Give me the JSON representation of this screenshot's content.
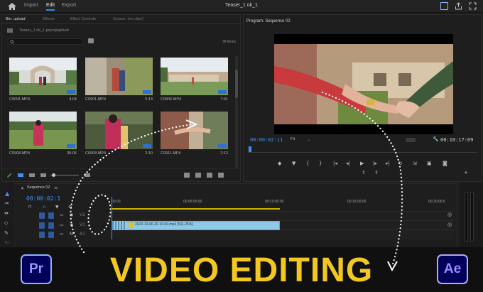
{
  "topbar": {
    "menus": [
      "Import",
      "Edit",
      "Export"
    ],
    "active_menu": "Edit",
    "title": "Teaser_1 ok_1"
  },
  "bin": {
    "tabs": [
      "Bin: upload",
      "Effects",
      "Effect Controls",
      "Source: (no clips)"
    ],
    "path": "Teaser_1 ok_1.prproj\\upload",
    "item_count": "38 Items",
    "clips": [
      {
        "name": "C0091.MP4",
        "duration": "4:04"
      },
      {
        "name": "C0901.MP4",
        "duration": "5:13"
      },
      {
        "name": "C0906.MP4",
        "duration": "7:01"
      },
      {
        "name": "C0908.MP4",
        "duration": "30:06"
      },
      {
        "name": "C0908.MP4",
        "duration": "2:10"
      },
      {
        "name": "C0911.MP4",
        "duration": "2:12"
      }
    ]
  },
  "program": {
    "title": "Program: Sequence 02",
    "timecode": "00:00:02:11",
    "fit": "Fit",
    "duration": "00:10:17:09"
  },
  "timeline": {
    "sequence": "Sequence 02",
    "timecode": "00:00:02:1",
    "ticks": [
      "00:00",
      "00:05:00:00",
      "00:10:00:00",
      "00:15:00:00",
      "00:20:00:0"
    ],
    "clip_label": "2023-10-06 20-10-00.mp4 [511.25%]",
    "track_labels": [
      "V2",
      "V1",
      "A1"
    ]
  },
  "banner": {
    "headline": "VIDEO EDITING",
    "logo_left": "Pr",
    "logo_right": "Ae"
  },
  "colors": {
    "accent_blue": "#3e90f5",
    "headline_yellow": "#f3c722",
    "clip_blue": "#8fc9e6"
  }
}
